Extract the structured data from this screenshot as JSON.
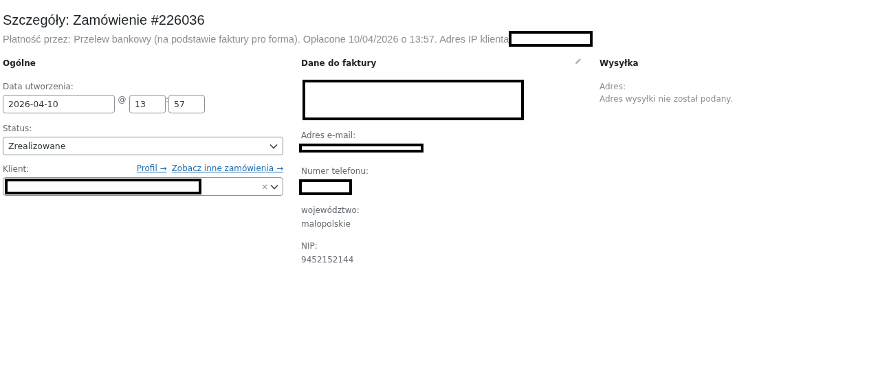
{
  "title": "Szczegóły: Zamówienie #226036",
  "subtitle": "Płatność przez: Przelew bankowy (na podstawie faktury pro forma). Opłacone 10/04/2026 o 13:57. Adres IP klienta",
  "general": {
    "heading": "Ogólne",
    "date_label": "Data utworzenia:",
    "date": "2026-04-10",
    "at": "@",
    "hour": "13",
    "colon": ":",
    "minute": "57",
    "status_label": "Status:",
    "status": "Zrealizowane",
    "client_label": "Klient:",
    "links": [
      {
        "label": "Profil →"
      },
      {
        "label": "Zobacz inne zamówienia →"
      }
    ],
    "clear": "×"
  },
  "billing": {
    "heading": "Dane do faktury",
    "fields": [
      {
        "kind": "redacted-block"
      },
      {
        "kind": "redacted-line",
        "label": "Adres e-mail:"
      },
      {
        "kind": "redacted-short",
        "label": "Numer telefonu:"
      },
      {
        "kind": "text",
        "label": "województwo:",
        "value": "malopolskie"
      },
      {
        "kind": "text",
        "label": "NIP:",
        "value": "9452152144"
      }
    ]
  },
  "shipping": {
    "heading": "Wysyłka",
    "label": "Adres:",
    "value": "Adres wysyłki nie został podany."
  }
}
